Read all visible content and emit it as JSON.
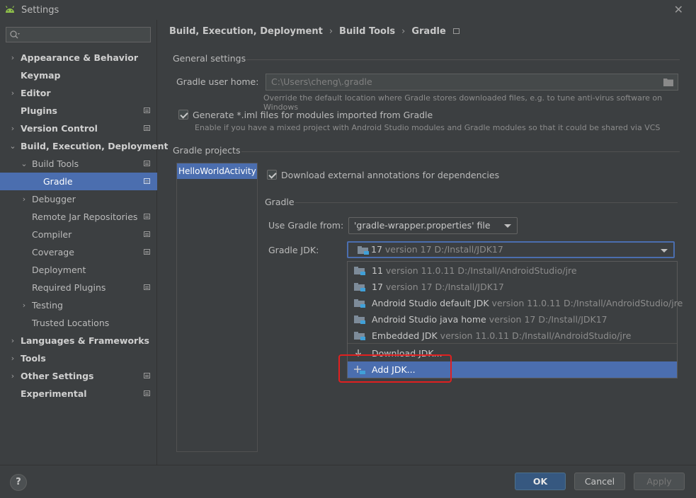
{
  "window": {
    "title": "Settings",
    "close_glyph": "✕"
  },
  "search": {
    "placeholder": "",
    "icon": "search-icon"
  },
  "sidebar": {
    "items": [
      {
        "label": "Appearance & Behavior",
        "level": 0,
        "bold": true,
        "arrow": "›",
        "pin": false
      },
      {
        "label": "Keymap",
        "level": 0,
        "bold": true,
        "arrow": "",
        "pin": false
      },
      {
        "label": "Editor",
        "level": 0,
        "bold": true,
        "arrow": "›",
        "pin": false
      },
      {
        "label": "Plugins",
        "level": 0,
        "bold": true,
        "arrow": "",
        "pin": true
      },
      {
        "label": "Version Control",
        "level": 0,
        "bold": true,
        "arrow": "›",
        "pin": true
      },
      {
        "label": "Build, Execution, Deployment",
        "level": 0,
        "bold": true,
        "arrow": "⌄",
        "pin": false
      },
      {
        "label": "Build Tools",
        "level": 1,
        "bold": false,
        "arrow": "⌄",
        "pin": true
      },
      {
        "label": "Gradle",
        "level": 2,
        "bold": false,
        "arrow": "",
        "pin": true,
        "selected": true
      },
      {
        "label": "Debugger",
        "level": 1,
        "bold": false,
        "arrow": "›",
        "pin": false
      },
      {
        "label": "Remote Jar Repositories",
        "level": 1,
        "bold": false,
        "arrow": "",
        "pin": true
      },
      {
        "label": "Compiler",
        "level": 1,
        "bold": false,
        "arrow": "",
        "pin": true
      },
      {
        "label": "Coverage",
        "level": 1,
        "bold": false,
        "arrow": "",
        "pin": true
      },
      {
        "label": "Deployment",
        "level": 1,
        "bold": false,
        "arrow": "",
        "pin": false
      },
      {
        "label": "Required Plugins",
        "level": 1,
        "bold": false,
        "arrow": "",
        "pin": true
      },
      {
        "label": "Testing",
        "level": 1,
        "bold": false,
        "arrow": "›",
        "pin": false
      },
      {
        "label": "Trusted Locations",
        "level": 1,
        "bold": false,
        "arrow": "",
        "pin": false
      },
      {
        "label": "Languages & Frameworks",
        "level": 0,
        "bold": true,
        "arrow": "›",
        "pin": false
      },
      {
        "label": "Tools",
        "level": 0,
        "bold": true,
        "arrow": "›",
        "pin": false
      },
      {
        "label": "Other Settings",
        "level": 0,
        "bold": true,
        "arrow": "›",
        "pin": true
      },
      {
        "label": "Experimental",
        "level": 0,
        "bold": true,
        "arrow": "",
        "pin": true
      }
    ]
  },
  "breadcrumb": {
    "items": [
      "Build, Execution, Deployment",
      "Build Tools",
      "Gradle"
    ],
    "separator": "›"
  },
  "general": {
    "heading": "General settings",
    "user_home_label": "Gradle user home:",
    "user_home_value": "C:\\Users\\cheng\\.gradle",
    "user_home_hint": "Override the default location where Gradle stores downloaded files, e.g. to tune anti-virus software on Windows",
    "iml_label": "Generate *.iml files for modules imported from Gradle",
    "iml_hint": "Enable if you have a mixed project with Android Studio modules and Gradle modules so that it could be shared via VCS"
  },
  "projects": {
    "heading": "Gradle projects",
    "list": [
      "HelloWorldActivity"
    ],
    "annotations_label": "Download external annotations for dependencies",
    "gradle_heading": "Gradle",
    "use_from_label": "Use Gradle from:",
    "use_from_value": "'gradle-wrapper.properties' file",
    "jdk_label": "Gradle JDK:",
    "jdk_value_name": "17",
    "jdk_value_detail": "version 17 D:/Install/JDK17"
  },
  "jdk_popup": {
    "items": [
      {
        "name": "11",
        "detail": "version 11.0.11 D:/Install/AndroidStudio/jre",
        "icon": "folder-jdk-icon"
      },
      {
        "name": "17",
        "detail": "version 17 D:/Install/JDK17",
        "icon": "folder-jdk-icon"
      },
      {
        "name": "Android Studio default JDK",
        "detail": "version 11.0.11 D:/Install/AndroidStudio/jre",
        "icon": "folder-jdk-icon"
      },
      {
        "name": "Android Studio java home",
        "detail": "version 17 D:/Install/JDK17",
        "icon": "folder-jdk-icon"
      },
      {
        "name": "Embedded JDK",
        "detail": "version 11.0.11 D:/Install/AndroidStudio/jre",
        "icon": "folder-jdk-icon"
      }
    ],
    "download_label": "Download JDK...",
    "add_label": "Add JDK..."
  },
  "buttons": {
    "help": "?",
    "ok": "OK",
    "cancel": "Cancel",
    "apply": "Apply"
  }
}
